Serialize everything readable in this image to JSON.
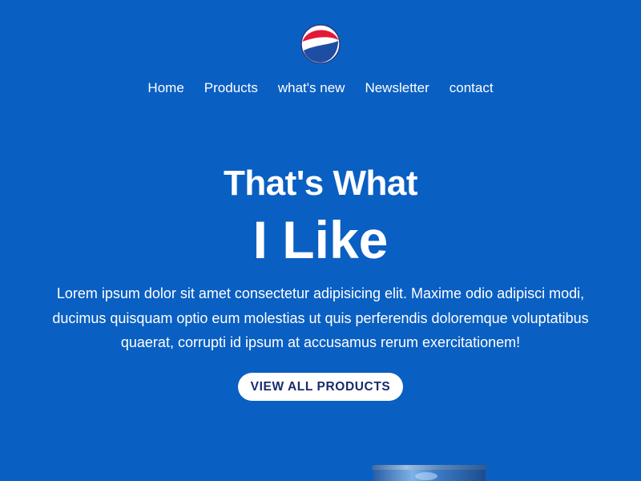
{
  "brand": {
    "logo_icon": "pepsi-globe-icon",
    "colors": {
      "background": "#0a5fc2",
      "red": "#e31837",
      "blue": "#1e4ea3",
      "white": "#ffffff"
    }
  },
  "nav": {
    "items": [
      {
        "label": "Home"
      },
      {
        "label": "Products"
      },
      {
        "label": "what's new"
      },
      {
        "label": "Newsletter"
      },
      {
        "label": "contact"
      }
    ]
  },
  "hero": {
    "line1": "That's What",
    "line2": "I Like",
    "description": "Lorem ipsum dolor sit amet consectetur adipisicing elit. Maxime odio adipisci modi, ducimus quisquam optio eum molestias ut quis perferendis doloremque voluptatibus quaerat, corrupti id ipsum at accusamus rerum exercitationem!",
    "cta_label": "VIEW ALL PRODUCTS"
  },
  "product": {
    "icon": "pepsi-can-icon"
  }
}
